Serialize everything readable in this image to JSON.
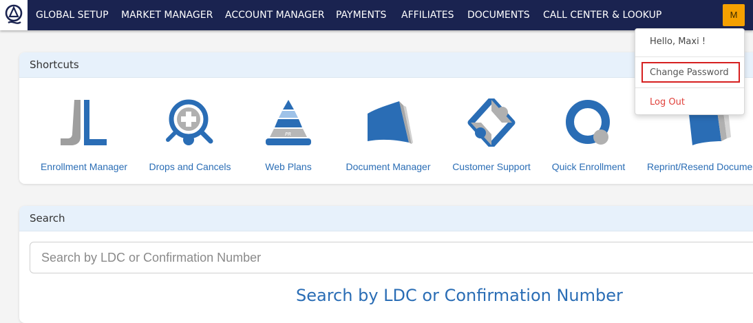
{
  "nav": {
    "logo": "brand-logo",
    "items": [
      {
        "label": "GLOBAL SETUP"
      },
      {
        "label": "MARKET MANAGER"
      },
      {
        "label": "ACCOUNT MANAGER"
      },
      {
        "label": "PAYMENTS"
      },
      {
        "label": "AFFILIATES"
      },
      {
        "label": "DOCUMENTS"
      },
      {
        "label": "CALL CENTER & LOOKUP"
      }
    ],
    "avatar_initial": "M"
  },
  "user_menu": {
    "greeting": "Hello, Maxi !",
    "change_password": "Change Password",
    "logout": "Log Out",
    "logout_color": "#e0413b"
  },
  "shortcuts": {
    "title": "Shortcuts",
    "items": [
      {
        "label": "Enrollment Manager",
        "icon": "enrollment-manager-icon"
      },
      {
        "label": "Drops and Cancels",
        "icon": "drops-cancels-icon"
      },
      {
        "label": "Web Plans",
        "icon": "web-plans-icon"
      },
      {
        "label": "Document Manager",
        "icon": "document-manager-icon"
      },
      {
        "label": "Customer Support",
        "icon": "customer-support-icon"
      },
      {
        "label": "Quick Enrollment",
        "icon": "quick-enrollment-icon"
      },
      {
        "label": "Reprint/Resend Docume",
        "icon": "reprint-resend-icon"
      }
    ]
  },
  "search": {
    "title": "Search",
    "placeholder": "Search by LDC or Confirmation Number",
    "heading": "Search by LDC or Confirmation Number"
  },
  "colors": {
    "nav_bg": "#1a2350",
    "accent": "#2a6db5",
    "avatar_bg": "#f5a000",
    "highlight_border": "#d61f1f"
  }
}
